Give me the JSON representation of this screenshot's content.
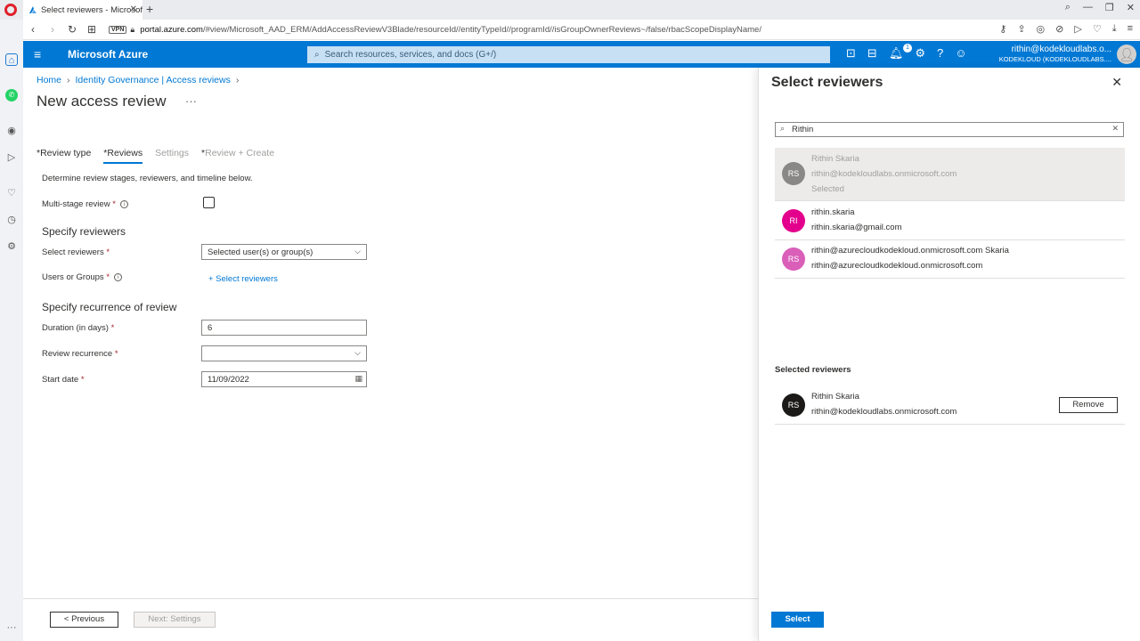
{
  "browser": {
    "tab_title": "Select reviewers - Microsof",
    "vpn": "VPN",
    "url_host": "portal.azure.com",
    "url_path": "/#view/Microsoft_AAD_ERM/AddAccessReviewV3Blade/resourceId//entityTypeId//programId//isGroupOwnerReviews~/false/rbacScopeDisplayName/"
  },
  "azure": {
    "brand": "Microsoft Azure",
    "search_placeholder": "Search resources, services, and docs (G+/)",
    "notification_count": "1",
    "account_email": "rithin@kodekloudlabs.o...",
    "account_tenant": "KODEKLOUD (KODEKLOUDLABS...."
  },
  "breadcrumb": [
    "Home",
    "Identity Governance | Access reviews"
  ],
  "page": {
    "title": "New access review",
    "more": "···",
    "tabs": [
      {
        "req": "*",
        "label": "Review type"
      },
      {
        "req": "*",
        "label": "Reviews"
      },
      {
        "req": "",
        "label": "Settings"
      },
      {
        "req": "*",
        "label": "Review + Create"
      }
    ],
    "description": "Determine review stages, reviewers, and timeline below.",
    "multi_stage_label": "Multi-stage review",
    "specify_reviewers": "Specify reviewers",
    "select_reviewers_label": "Select reviewers",
    "select_reviewers_value": "Selected user(s) or group(s)",
    "users_groups_label": "Users or Groups",
    "select_reviewers_link": "+ Select reviewers",
    "specify_recurrence": "Specify recurrence of review",
    "duration_label": "Duration (in days)",
    "duration_value": "6",
    "recurrence_label": "Review recurrence",
    "recurrence_value": "",
    "start_date_label": "Start date",
    "start_date_value": "11/09/2022",
    "required_star": "*",
    "previous_button": "< Previous",
    "next_button": "Next: Settings"
  },
  "blade": {
    "title": "Select reviewers",
    "search_value": "Rithin",
    "results": [
      {
        "initials": "RS",
        "line1": "Rithin Skaria",
        "line2": "rithin@kodekloudlabs.onmicrosoft.com",
        "line3": "Selected",
        "color": "#8a8886"
      },
      {
        "initials": "RI",
        "line1": "rithin.skaria",
        "line2": "rithin.skaria@gmail.com",
        "color": "#e3008c"
      },
      {
        "initials": "RS",
        "line1": "rithin@azurecloudkodekloud.onmicrosoft.com Skaria",
        "line2": "rithin@azurecloudkodekloud.onmicrosoft.com",
        "color": "#da5fb9"
      }
    ],
    "selected_heading": "Selected reviewers",
    "selected": {
      "initials": "RS",
      "name": "Rithin Skaria",
      "email": "rithin@kodekloudlabs.onmicrosoft.com",
      "color": "#1b1a19"
    },
    "remove_button": "Remove",
    "select_button": "Select"
  },
  "colors": {
    "azure_blue": "#0078d4",
    "required_red": "#a4262c"
  }
}
